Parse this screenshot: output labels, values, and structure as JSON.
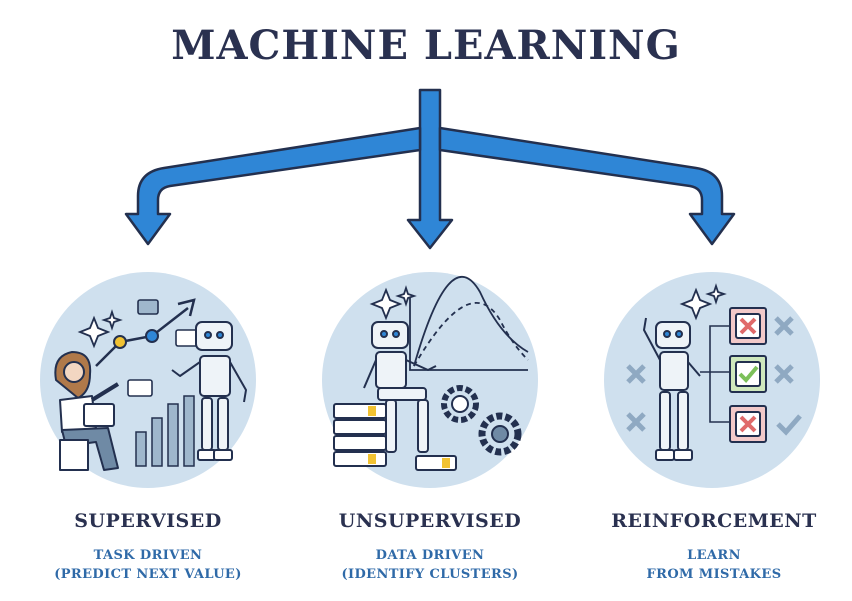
{
  "title": "MACHINE LEARNING",
  "categories": [
    {
      "name": "SUPERVISED",
      "line1": "TASK DRIVEN",
      "line2": "(PREDICT NEXT VALUE)"
    },
    {
      "name": "UNSUPERVISED",
      "line1": "DATA DRIVEN",
      "line2": "(IDENTIFY CLUSTERS)"
    },
    {
      "name": "REINFORCEMENT",
      "line1": "LEARN",
      "line2": "FROM MISTAKES"
    }
  ],
  "colors": {
    "title": "#2a3150",
    "arrow": "#2f86d6",
    "circle": "#cfe0ee",
    "subtitle": "#2f6aa8",
    "cross": "#e06a6a",
    "check": "#7cc05a",
    "robot": "#eef3f8"
  },
  "icons": [
    "arrow-icon",
    "robot-icon",
    "person-icon",
    "server-stack-icon",
    "gear-icon",
    "cross-icon",
    "check-icon",
    "sparkle-icon",
    "graph-icon"
  ]
}
